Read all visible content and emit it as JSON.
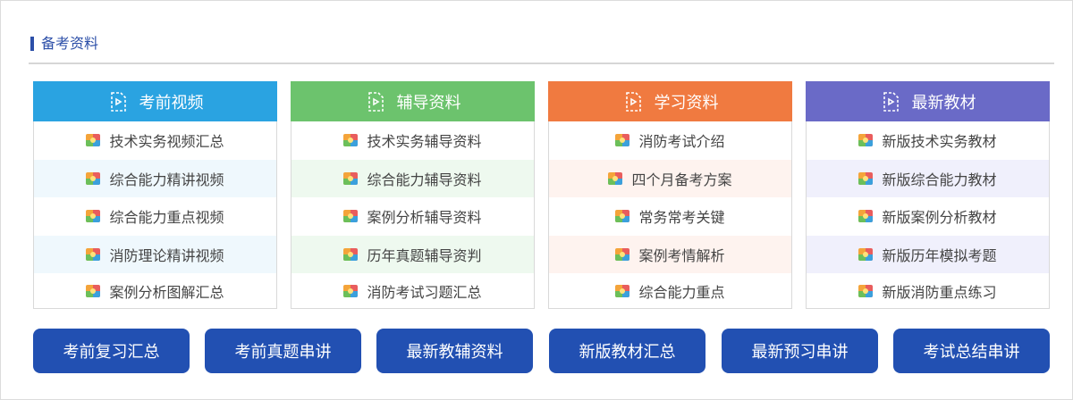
{
  "section": {
    "title": "备考资料"
  },
  "panels": [
    {
      "title": "考前视频",
      "header_color": "#2aa3e1",
      "stripe_color": "#eff8fd",
      "items": [
        "技术实务视频汇总",
        "综合能力精讲视频",
        "综合能力重点视频",
        "消防理论精讲视频",
        "案例分析图解汇总"
      ]
    },
    {
      "title": "辅导资料",
      "header_color": "#6cc36d",
      "stripe_color": "#eef9ef",
      "items": [
        "技术实务辅导资料",
        "综合能力辅导资料",
        "案例分析辅导资料",
        "历年真题辅导资判",
        "消防考试习题汇总"
      ]
    },
    {
      "title": "学习资料",
      "header_color": "#f07a40",
      "stripe_color": "#fef3ef",
      "items": [
        "消防考试介绍",
        "四个月备考方案",
        "常务常考关键",
        "案例考情解析",
        "综合能力重点"
      ]
    },
    {
      "title": "最新教材",
      "header_color": "#6a6ac7",
      "stripe_color": "#f0f0fc",
      "items": [
        "新版技术实务教材",
        "新版综合能力教材",
        "新版案例分析教材",
        "新版历年模拟考题",
        "新版消防重点练习"
      ]
    }
  ],
  "buttons": [
    "考前复习汇总",
    "考前真题串讲",
    "最新教辅资料",
    "新版教材汇总",
    "最新预习串讲",
    "考试总结串讲"
  ]
}
